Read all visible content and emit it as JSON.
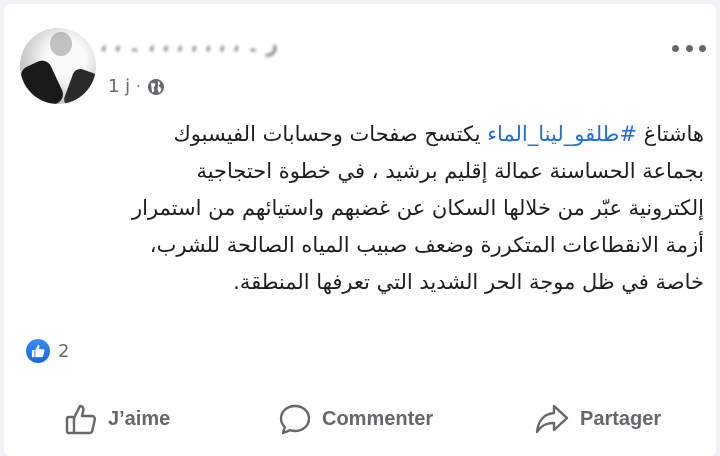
{
  "post": {
    "author_name": "ر ۔ ، ، ، ، ، ، ، ۔ ، ،",
    "time": "1 j",
    "separator": "·",
    "privacy_icon": "globe-icon",
    "more_icon": "more-dots-icon",
    "text_prefix": "هاشتاغ ",
    "hashtag": "#طلقو_لينا_الماء",
    "text_lines_after_hashtag": " يكتسح صفحات وحسابات الفيسبوك",
    "text_line_2": "بجماعة الحساسنة عمالة إقليم برشيد ، في خطوة احتجاجية",
    "text_line_3": "إلكترونية عبّر من خلالها السكان عن غضبهم واستيائهم من استمرار",
    "text_line_4": "أزمة الانقطاعات المتكررة وضعف صبيب المياه الصالحة للشرب،",
    "text_line_5": "خاصة في ظل موجة الحر الشديد التي تعرفها المنطقة."
  },
  "reactions": {
    "icon": "like-reaction-icon",
    "count": "2"
  },
  "actions": {
    "like_label": "J’aime",
    "comment_label": "Commenter",
    "share_label": "Partager"
  },
  "colors": {
    "link": "#216fdb",
    "text": "#1c1e21",
    "muted": "#65676b",
    "like_blue": "#1766e0"
  }
}
